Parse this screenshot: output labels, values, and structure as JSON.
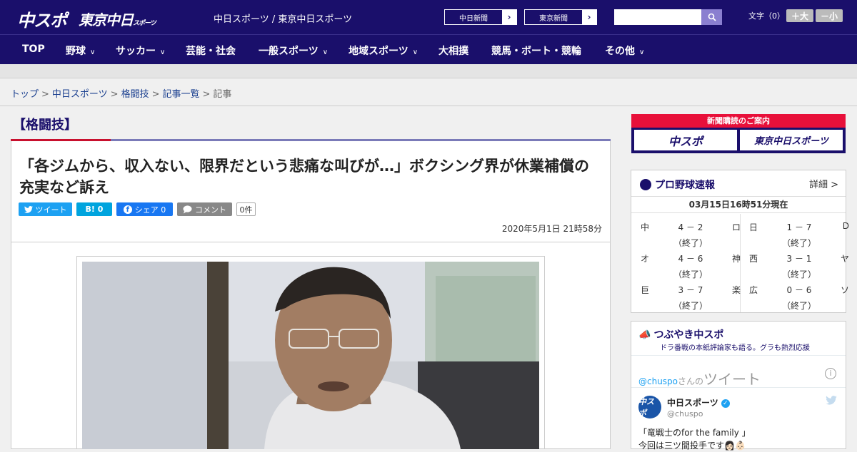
{
  "header": {
    "logo_chuspo": "中スポ",
    "logo_tokyo": "東京中日",
    "logo_tokyo_sub": "スポーツ",
    "site_links": "中日スポーツ / 東京中日スポーツ",
    "paper_buttons": [
      "中日新聞",
      "東京新聞"
    ],
    "font_label": "文字（0）",
    "font_larger": "＋大",
    "font_smaller": "－小"
  },
  "nav": {
    "items": [
      "TOP",
      "野球",
      "サッカー",
      "芸能・社会",
      "一般スポーツ",
      "地域スポーツ",
      "大相撲",
      "競馬・ボート・競輪",
      "その他"
    ]
  },
  "breadcrumb": {
    "items": [
      "トップ",
      "中日スポーツ",
      "格闘技",
      "記事一覧"
    ],
    "current": "記事",
    "separator": ">"
  },
  "article": {
    "category": "【格闘技】",
    "headline": "「各ジムから、収入ない、限界だという悲痛な叫びが…」ボクシング界が休業補償の充実など訴え",
    "date": "2020年5月1日 21時58分",
    "share": {
      "tweet": "ツイート",
      "hatena": "B! 0",
      "facebook": "シェア 0",
      "comment": "コメント",
      "comment_count": "0件"
    }
  },
  "sidebar": {
    "subscribe": {
      "title": "新聞購読のご案内",
      "buttons": [
        "中スポ",
        "東京中日スポーツ"
      ]
    },
    "scores": {
      "title": "プロ野球速報",
      "detail": "詳細 >",
      "time": "03月15日16時51分現在",
      "games": [
        {
          "t1": "中",
          "score": "4 － 2",
          "t2": "ロ",
          "status": "（終了）"
        },
        {
          "t1": "日",
          "score": "1 － 7",
          "t2": "D",
          "status": "（終了）"
        },
        {
          "t1": "オ",
          "score": "4 － 6",
          "t2": "神",
          "status": "（終了）"
        },
        {
          "t1": "西",
          "score": "3 － 1",
          "t2": "ヤ",
          "status": "（終了）"
        },
        {
          "t1": "巨",
          "score": "3 － 7",
          "t2": "楽",
          "status": "（終了）"
        },
        {
          "t1": "広",
          "score": "0 － 6",
          "t2": "ソ",
          "status": "（終了）"
        }
      ]
    },
    "tweets": {
      "title": "つぶやき中スポ",
      "subtitle": "ドラ番戦の本紙評論家も語る。グラも熱烈応援",
      "handle": "@chuspo",
      "handle_suffix": "さんの",
      "word": "ツイート",
      "author": "中日スポーツ",
      "author_handle": "@chuspo",
      "avatar_text": "中スポ",
      "text_line1": "「竜戦士のfor the family 」",
      "text_line2": "今回は三ツ間投手です👩🏻👶🏻"
    }
  }
}
